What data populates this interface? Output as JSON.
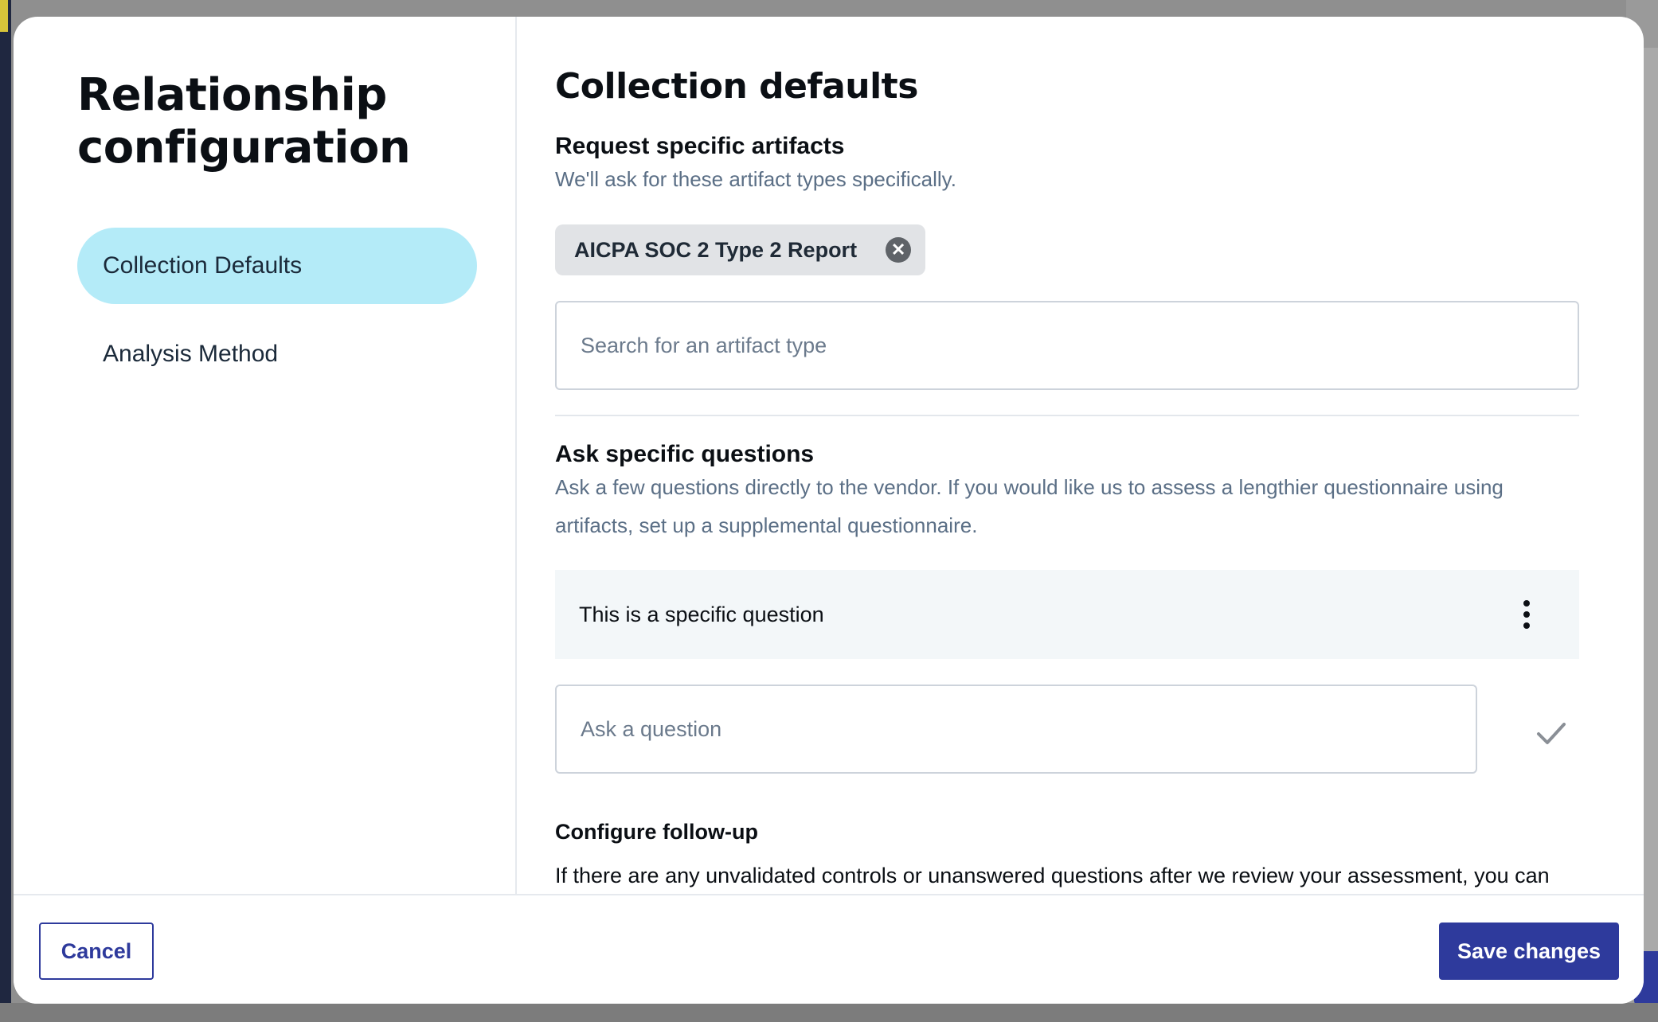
{
  "sidebar": {
    "title": "Relationship configuration",
    "items": [
      {
        "label": "Collection Defaults",
        "active": true
      },
      {
        "label": "Analysis Method",
        "active": false
      }
    ]
  },
  "main": {
    "title": "Collection defaults",
    "artifacts": {
      "heading": "Request specific artifacts",
      "description": "We'll ask for these artifact types specifically.",
      "chips": [
        "AICPA SOC 2 Type 2 Report"
      ],
      "search_placeholder": "Search for an artifact type",
      "search_value": ""
    },
    "questions": {
      "heading": "Ask specific questions",
      "description": "Ask a few questions directly to the vendor. If you would like us to assess a lengthier questionnaire using artifacts, set up a supplemental questionnaire.",
      "items": [
        "This is a specific question"
      ],
      "input_placeholder": "Ask a question",
      "input_value": ""
    },
    "followup": {
      "heading": "Configure follow-up",
      "text": "If there are any unvalidated controls or unanswered questions after we review your assessment, you can"
    }
  },
  "footer": {
    "cancel_label": "Cancel",
    "save_label": "Save changes"
  },
  "colors": {
    "accent": "#2e3a9c",
    "nav_active_bg": "#b4ebf8",
    "muted_text": "#5b6f86"
  },
  "icons": [
    "close-circle-icon",
    "more-vertical-icon",
    "check-icon"
  ]
}
